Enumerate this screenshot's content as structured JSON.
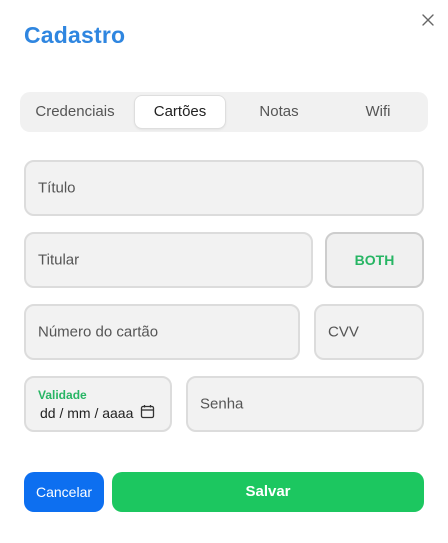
{
  "dialog": {
    "title": "Cadastro",
    "close_icon": "close-icon"
  },
  "tabs": [
    {
      "label": "Credenciais",
      "active": false
    },
    {
      "label": "Cartões",
      "active": true
    },
    {
      "label": "Notas",
      "active": false
    },
    {
      "label": "Wifi",
      "active": false
    }
  ],
  "form": {
    "titulo": {
      "placeholder": "Título",
      "value": ""
    },
    "titular": {
      "placeholder": "Titular",
      "value": ""
    },
    "card_type": {
      "value": "BOTH"
    },
    "numero": {
      "placeholder": "Número do cartão",
      "value": ""
    },
    "cvv": {
      "placeholder": "CVV",
      "value": ""
    },
    "validade": {
      "label": "Validade",
      "value": "dd / mm / aaaa",
      "icon": "calendar-icon"
    },
    "senha": {
      "placeholder": "Senha",
      "value": ""
    }
  },
  "actions": {
    "cancel_label": "Cancelar",
    "save_label": "Salvar"
  },
  "colors": {
    "title": "#2f86e0",
    "accent_green": "#1cc760",
    "cancel_blue": "#0d6ff0",
    "toggle_text": "#27b564"
  }
}
